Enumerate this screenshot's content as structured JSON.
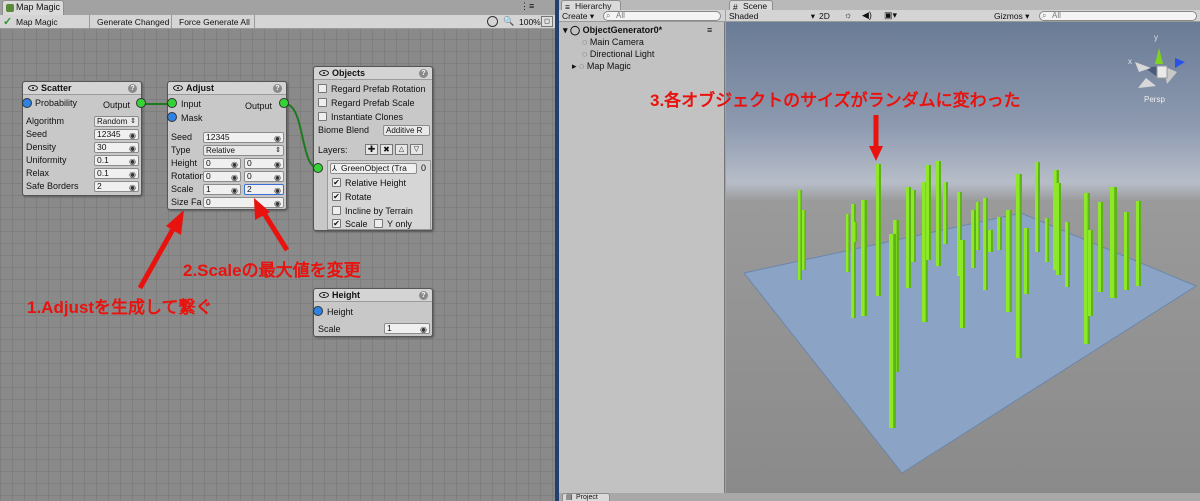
{
  "mapmagic": {
    "tab_title": "Map Magic",
    "toolbar": {
      "name": "Map Magic",
      "generate_changed": "Generate Changed",
      "force_generate_all": "Force Generate All",
      "zoom": "100%"
    },
    "scatter": {
      "title": "Scatter",
      "probability": "Probability",
      "output": "Output",
      "algorithm_label": "Algorithm",
      "algorithm_value": "Random",
      "seed_label": "Seed",
      "seed_value": "12345",
      "density_label": "Density",
      "density_value": "30",
      "uniformity_label": "Uniformity",
      "uniformity_value": "0.1",
      "relax_label": "Relax",
      "relax_value": "0.1",
      "safe_borders_label": "Safe Borders",
      "safe_borders_value": "2"
    },
    "adjust": {
      "title": "Adjust",
      "input": "Input",
      "output": "Output",
      "mask": "Mask",
      "seed_label": "Seed",
      "seed_value": "12345",
      "type_label": "Type",
      "type_value": "Relative",
      "height_label": "Height",
      "height_min": "0",
      "height_max": "0",
      "rotation_label": "Rotation",
      "rotation_min": "0",
      "rotation_max": "0",
      "scale_label": "Scale",
      "scale_min": "1",
      "scale_max": "2",
      "sizefactor_label": "Size Fa",
      "sizefactor_value": "0"
    },
    "objects": {
      "title": "Objects",
      "regard_rotation": "Regard Prefab Rotation",
      "regard_scale": "Regard Prefab Scale",
      "instantiate_clones": "Instantiate Clones",
      "biome_blend_label": "Biome Blend",
      "biome_blend_value": "Additive R",
      "layers_label": "Layers:",
      "layer_object": "GreenObject (Tra",
      "layer_count": "0",
      "relative_height": "Relative Height",
      "rotate": "Rotate",
      "incline_by_terrain": "Incline by Terrain",
      "scale": "Scale",
      "y_only": "Y only"
    },
    "height_node": {
      "title": "Height",
      "height_port": "Height",
      "scale_label": "Scale",
      "scale_value": "1"
    }
  },
  "hierarchy": {
    "tab_title": "Hierarchy",
    "create": "Create",
    "search_placeholder": "All",
    "root": "ObjectGenerator0*",
    "items": [
      "Main Camera",
      "Directional Light",
      "Map Magic"
    ]
  },
  "scene": {
    "tab_title": "Scene",
    "shading": "Shaded",
    "mode_2d": "2D",
    "gizmos": "Gizmos",
    "search_placeholder": "All",
    "persp": "Persp",
    "axis_y": "y",
    "axis_x": "x"
  },
  "project_tab": "Project",
  "annotations": {
    "step1": "1.Adjustを生成して繋ぐ",
    "step2": "2.Scaleの最大値を変更",
    "step3": "3.各オブジェクトのサイズがランダムに変わった",
    "color": "#e8130e"
  },
  "colors": {
    "accent_green": "#34d434",
    "port_blue": "#2d82e6",
    "pillar": "#8ee82a",
    "divider": "#233f6e"
  }
}
